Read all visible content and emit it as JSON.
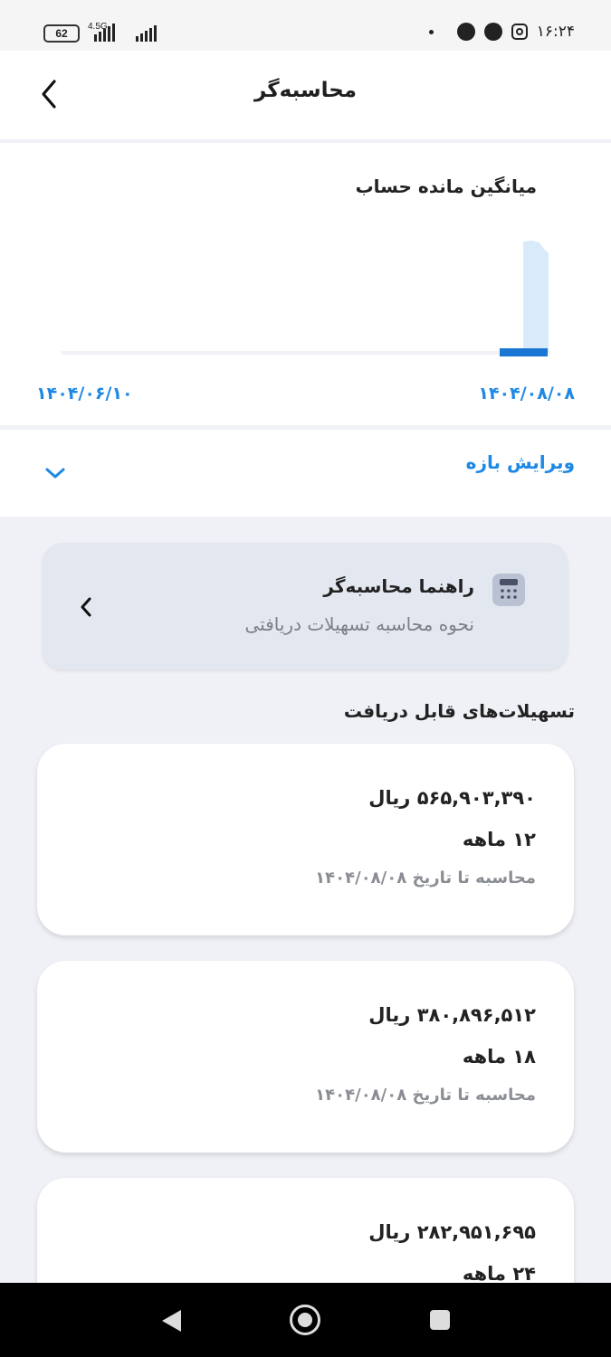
{
  "status_bar": {
    "time": "۱۶:۲۴",
    "battery": "62",
    "network": "4.5G"
  },
  "header": {
    "title": "محاسبه‌گر",
    "back_icon": "chevron-left-icon"
  },
  "chart_data": {
    "type": "bar",
    "title": "میانگین مانده حساب",
    "x_start_label": "۱۴۰۴/۰۶/۱۰",
    "x_end_label": "۱۴۰۴/۰۸/۰۸",
    "accent": "#1e88e5",
    "bar_light": "#d9eafb",
    "bar_dark": "#1976d2"
  },
  "edit_range": {
    "label": "ویرایش بازه",
    "icon": "chevron-down-icon"
  },
  "guide": {
    "title": "راهنما محاسبه‌گر",
    "subtitle": "نحوه محاسبه تسهیلات دریافتی",
    "icon": "calculator-icon"
  },
  "section_title": "تسهیلات‌های قابل دریافت",
  "loans": [
    {
      "amount": "۵۶۵,۹۰۳,۳۹۰ ریال",
      "term": "۱۲ ماهه",
      "date_note": "محاسبه تا تاریخ ۱۴۰۴/۰۸/۰۸"
    },
    {
      "amount": "۳۸۰,۸۹۶,۵۱۲ ریال",
      "term": "۱۸ ماهه",
      "date_note": "محاسبه تا تاریخ ۱۴۰۴/۰۸/۰۸"
    },
    {
      "amount": "۲۸۲,۹۵۱,۶۹۵ ریال",
      "term": "۲۴ ماهه",
      "date_note": ""
    }
  ]
}
